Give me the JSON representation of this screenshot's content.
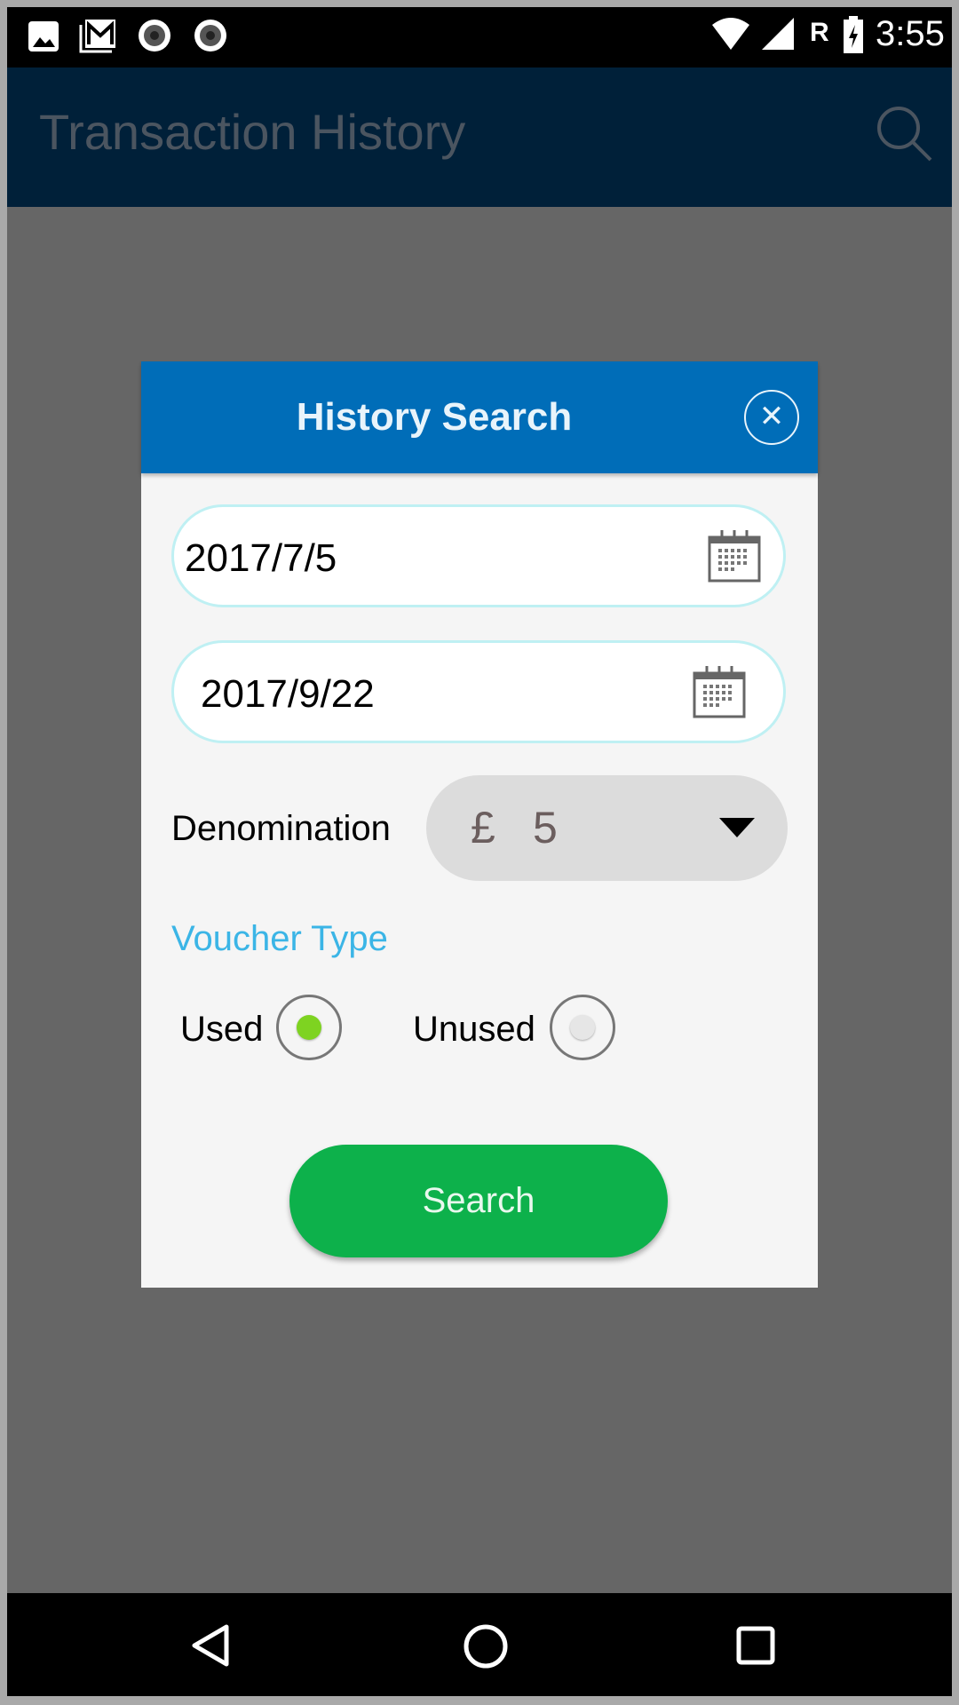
{
  "status_bar": {
    "time": "3:55",
    "roaming": "R",
    "icons": [
      "image-icon",
      "gmail-icon",
      "record-icon",
      "record-icon",
      "wifi-icon",
      "signal-icon",
      "battery-charging-icon"
    ]
  },
  "app_bar": {
    "title": "Transaction History",
    "action_icon": "search-icon"
  },
  "dialog": {
    "title": "History Search",
    "close_icon": "close-icon",
    "start_date": "2017/7/5",
    "end_date": "2017/9/22",
    "denomination_label": "Denomination",
    "denomination_currency": "£",
    "denomination_value": "5",
    "voucher_type_label": "Voucher Type",
    "options": [
      {
        "label": "Used",
        "selected": true
      },
      {
        "label": "Unused",
        "selected": false
      }
    ],
    "search_label": "Search"
  },
  "colors": {
    "header": "#006db8",
    "app_bar": "#002039",
    "search_button": "#0db14b",
    "voucher_label": "#3bb5e6",
    "radio_selected": "#7ed321"
  }
}
